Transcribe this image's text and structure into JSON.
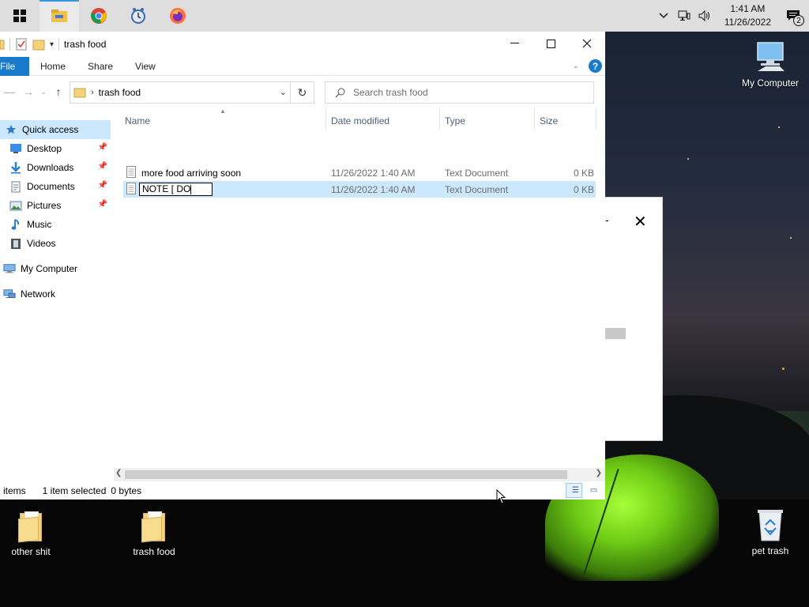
{
  "taskbar": {
    "clock_time": "1:41 AM",
    "clock_date": "11/26/2022",
    "notification_count": "2"
  },
  "window": {
    "title": "trash food",
    "ribbon_tabs": [
      "File",
      "Home",
      "Share",
      "View"
    ],
    "address_crumb": "trash food",
    "search_placeholder": "Search trash food"
  },
  "nav": {
    "quick_access": "Quick access",
    "items": [
      {
        "label": "Desktop",
        "icon": "desktop-icon",
        "pinned": true
      },
      {
        "label": "Downloads",
        "icon": "downloads-icon",
        "pinned": true
      },
      {
        "label": "Documents",
        "icon": "documents-icon",
        "pinned": true
      },
      {
        "label": "Pictures",
        "icon": "pictures-icon",
        "pinned": true
      },
      {
        "label": "Music",
        "icon": "music-icon",
        "pinned": false
      },
      {
        "label": "Videos",
        "icon": "videos-icon",
        "pinned": false
      }
    ],
    "my_computer": "My Computer",
    "network": "Network"
  },
  "columns": {
    "name": "Name",
    "date": "Date modified",
    "type": "Type",
    "size": "Size"
  },
  "files": [
    {
      "name": "more food arriving soon",
      "date": "11/26/2022 1:40 AM",
      "type": "Text Document",
      "size": "0 KB"
    },
    {
      "name": "NOTE [ DO",
      "date": "11/26/2022 1:40 AM",
      "type": "Text Document",
      "size": "0 KB",
      "renaming": true
    }
  ],
  "status": {
    "items": "items",
    "selected": "1 item selected",
    "bytes": "0 bytes"
  },
  "desktop_icons": {
    "my_computer": "My Computer",
    "other": "other shit",
    "trash_food": "trash food",
    "recycle": "pet trash"
  }
}
